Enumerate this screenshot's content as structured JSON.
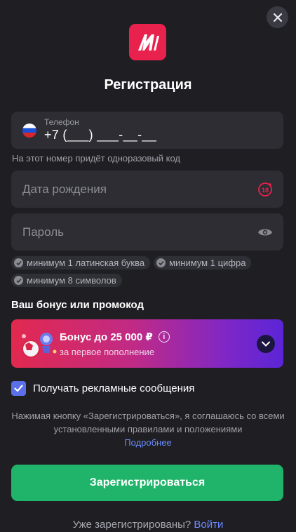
{
  "header": {
    "title": "Регистрация",
    "close_icon": "close-icon",
    "logo_icon": "brand-logo"
  },
  "phone": {
    "label": "Телефон",
    "value": "+7 (___) ___-__-__",
    "country_flag": "russia-flag-icon",
    "hint": "На этот номер придёт одноразовый код"
  },
  "birthdate": {
    "placeholder": "Дата рождения",
    "icon": "age-18-plus-icon"
  },
  "password": {
    "placeholder": "Пароль",
    "icon": "eye-icon",
    "requirements": [
      "минимум 1 латинская буква",
      "минимум 1 цифра",
      "минимум 8 символов"
    ]
  },
  "bonus": {
    "heading": "Ваш бонус или промокод",
    "title": "Бонус до 25 000 ₽",
    "subtitle": "за первое пополнение",
    "info_glyph": "i"
  },
  "marketing": {
    "checked": true,
    "label": "Получать рекламные сообщения"
  },
  "terms": {
    "text": "Нажимая кнопку «Зарегистрироваться», я соглашаюсь со всеми установленными правилами и положениями",
    "link": "Подробнее"
  },
  "submit": {
    "label": "Зарегистрироваться"
  },
  "footer": {
    "text": "Уже зарегистрированы?",
    "link": "Войти"
  },
  "colors": {
    "background": "#1e1e23",
    "field": "#2d2d33",
    "brand": "#e8214d",
    "accent_green": "#1fb46a",
    "link": "#6c8cff",
    "checkbox": "#5b6fe8"
  }
}
